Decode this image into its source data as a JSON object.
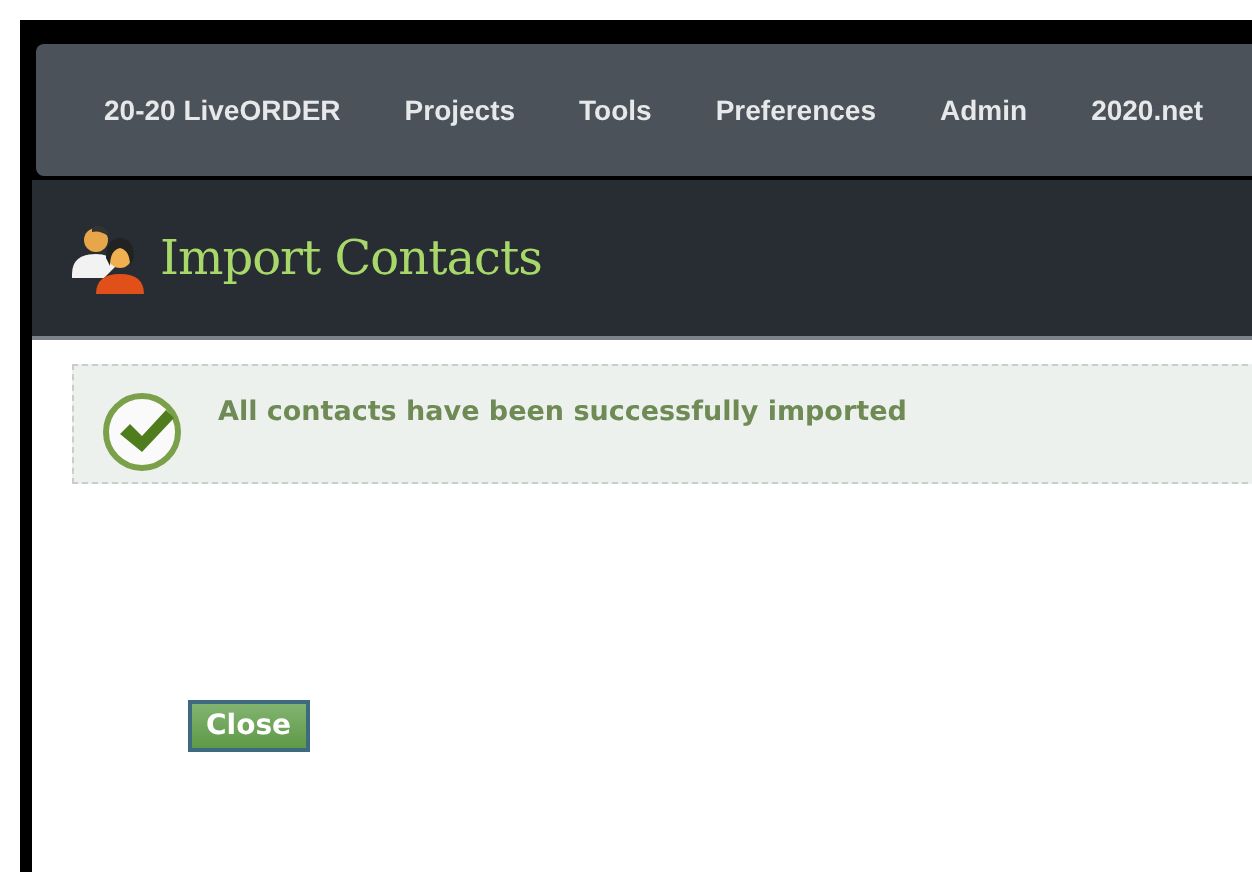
{
  "nav": {
    "items": [
      "20-20 LiveORDER",
      "Projects",
      "Tools",
      "Preferences",
      "Admin",
      "2020.net"
    ]
  },
  "header": {
    "title": "Import Contacts"
  },
  "message": {
    "kind": "success",
    "text": "All contacts have been successfully imported"
  },
  "buttons": [
    "Close"
  ]
}
